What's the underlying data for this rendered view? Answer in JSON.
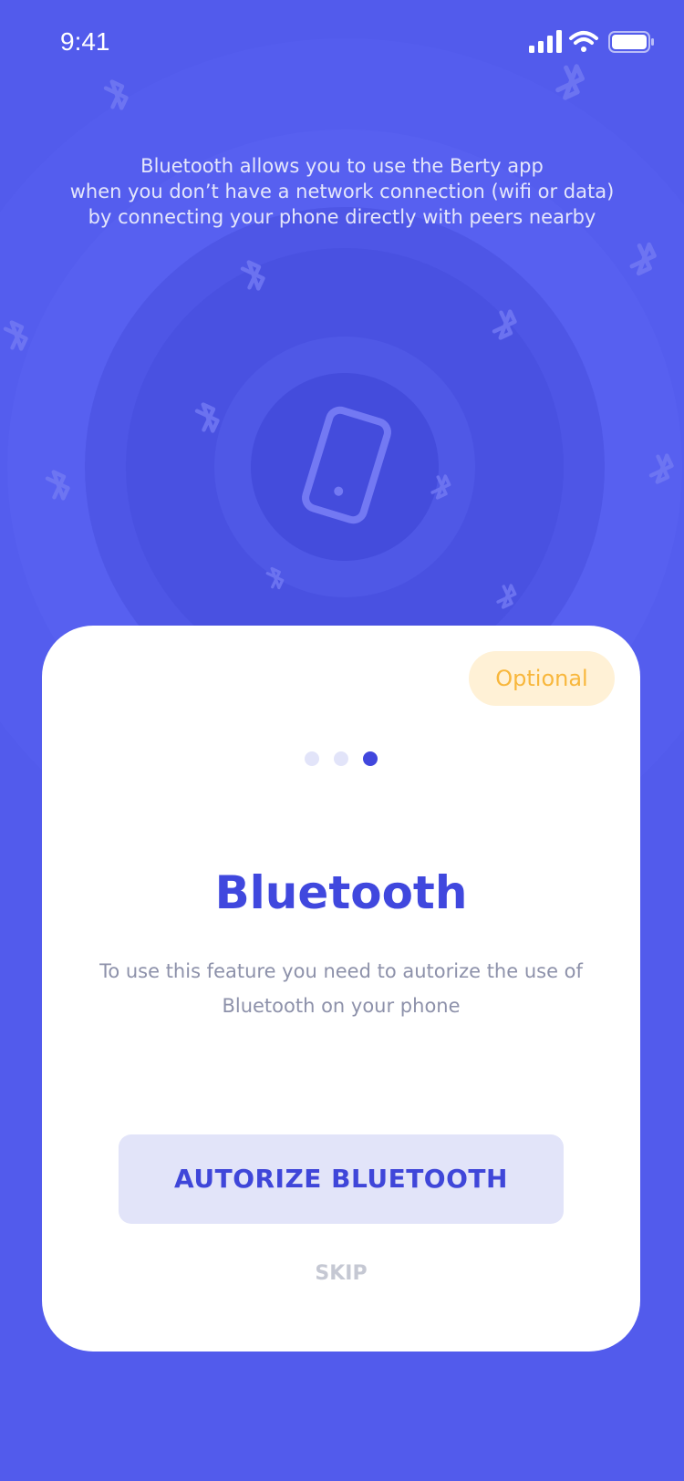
{
  "status_bar": {
    "time": "9:41",
    "signal_icon": "cellular-signal-icon",
    "wifi_icon": "wifi-icon",
    "battery_icon": "battery-icon"
  },
  "intro": {
    "lines": [
      "Bluetooth allows you to use the Berty app",
      "when you don’t have a network connection (wifi or data)",
      "by connecting your phone directly with peers nearby"
    ]
  },
  "illustration": {
    "phone_icon": "smartphone-icon",
    "scattered_icon": "bluetooth-icon"
  },
  "card": {
    "badge": "Optional",
    "pager": {
      "total": 3,
      "active": 3
    },
    "title": "Bluetooth",
    "description_lines": [
      "To use this feature you need to autorize the use of",
      "Bluetooth on your phone"
    ],
    "primary_button": "AUTORIZE BLUETOOTH",
    "skip_button": "SKIP"
  },
  "colors": {
    "background": "#525bec",
    "accent": "#4048de",
    "badge_bg": "#fff1d6",
    "badge_text": "#f8b73c",
    "button_bg": "#e2e4f9",
    "muted_text": "#8d91aa"
  }
}
